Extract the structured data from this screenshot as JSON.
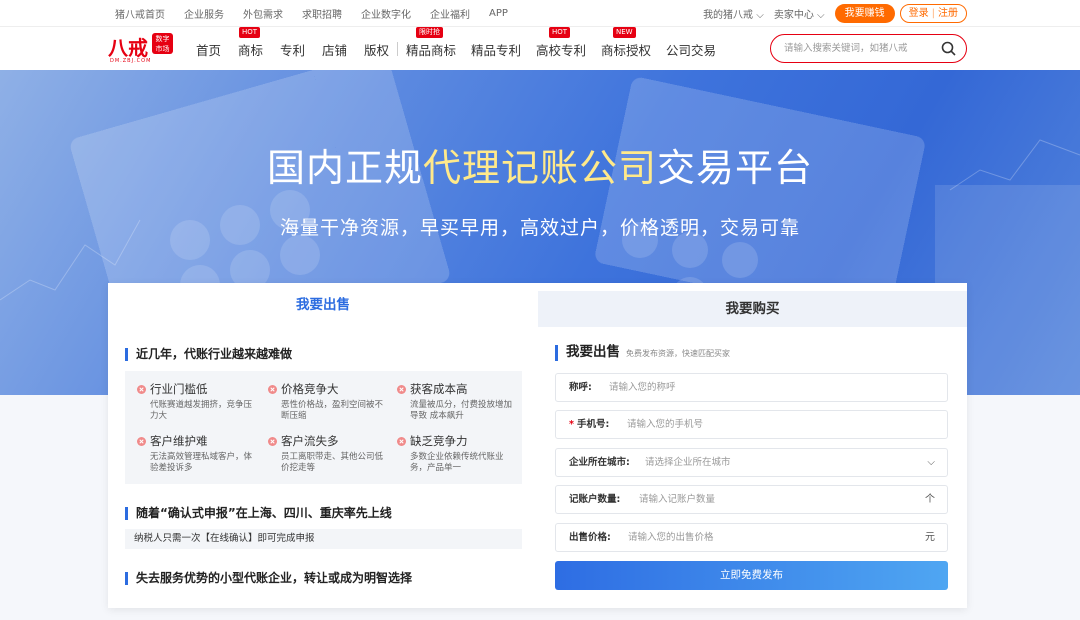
{
  "topbar": {
    "links": [
      "猪八戒首页",
      "企业服务",
      "外包需求",
      "求职招聘",
      "企业数字化",
      "企业福利",
      "APP"
    ],
    "my_zbj": "我的猪八戒",
    "seller_center": "卖家中心",
    "earn_button": "我要赚钱",
    "login": "登录",
    "register": "注册"
  },
  "logo": {
    "brand_text": "八戒",
    "seal_line1": "数字",
    "seal_line2": "市场",
    "sub": "DM.ZBJ.COM"
  },
  "nav": {
    "items": [
      {
        "label": "首页",
        "badge": ""
      },
      {
        "label": "商标",
        "badge": "HOT"
      },
      {
        "label": "专利",
        "badge": ""
      },
      {
        "label": "店铺",
        "badge": ""
      },
      {
        "label": "版权",
        "badge": ""
      },
      {
        "label": "精品商标",
        "badge": ""
      },
      {
        "label": "精品专利",
        "badge": ""
      },
      {
        "label": "高校专利",
        "badge": "HOT"
      },
      {
        "label": "商标授权",
        "badge": "NEW"
      },
      {
        "label": "公司交易",
        "badge": ""
      }
    ],
    "extra_badge": "限时抢",
    "search_placeholder": "请输入搜索关键词，如猪八戒"
  },
  "banner": {
    "title_pre": "国内正规",
    "title_hl": "代理记账公司",
    "title_post": "交易平台",
    "subtitle": "海量干净资源，早买早用，高效过户，价格透明，交易可靠"
  },
  "tabs": {
    "sell": "我要出售",
    "buy": "我要购买"
  },
  "left": {
    "section1_title": "近几年，代账行业越来越难做",
    "pain_points": [
      {
        "title": "行业门槛低",
        "desc": "代账赛道越发拥挤，竞争压力大"
      },
      {
        "title": "价格竞争大",
        "desc": "恶性价格战，盈利空间被不断压缩"
      },
      {
        "title": "获客成本高",
        "desc": "流量被瓜分，付费投放增加导致 成本飙升"
      },
      {
        "title": "客户维护难",
        "desc": "无法高效管理私域客户，体验差投诉多"
      },
      {
        "title": "客户流失多",
        "desc": "员工离职带走、其他公司低价挖走等"
      },
      {
        "title": "缺乏竞争力",
        "desc": "多数企业依赖传统代账业务，产品单一"
      }
    ],
    "section2_title": "随着“确认式申报”在上海、四川、重庆率先上线",
    "notice": "纳税人只需一次【在线确认】即可完成申报",
    "section3_title": "失去服务优势的小型代账企业，转让或成为明智选择"
  },
  "form": {
    "title": "我要出售",
    "subtitle": "免费发布资源，快速匹配买家",
    "name_label": "称呼:",
    "name_placeholder": "请输入您的称呼",
    "phone_label": "手机号:",
    "phone_placeholder": "请输入您的手机号",
    "city_label": "企业所在城市:",
    "city_placeholder": "请选择企业所在城市",
    "accounts_label": "记账户数量:",
    "accounts_placeholder": "请输入记账户数量",
    "accounts_unit": "个",
    "price_label": "出售价格:",
    "price_placeholder": "请输入您的出售价格",
    "price_unit": "元",
    "submit": "立即免费发布"
  },
  "colors": {
    "brand_red": "#e60012",
    "accent_orange": "#ff6a00",
    "primary_blue": "#2c6ce0",
    "highlight_yellow": "#ffe98a"
  }
}
